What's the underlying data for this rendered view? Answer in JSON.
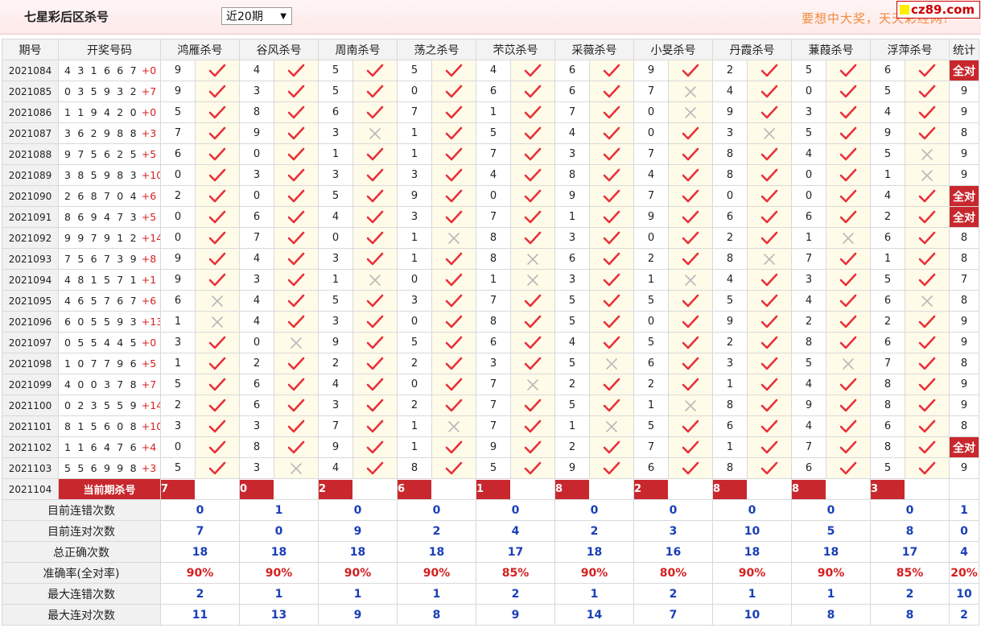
{
  "header": {
    "title": "七星彩后区杀号",
    "period_select": "近20期",
    "slogan": "要想中大奖，天天彩经网!",
    "site_badge": "cz89.com"
  },
  "columns": {
    "period": "期号",
    "numbers": "开奖号码",
    "experts": [
      "鸿雁杀号",
      "谷风杀号",
      "周南杀号",
      "荡之杀号",
      "芣苡杀号",
      "采薇杀号",
      "小旻杀号",
      "丹霞杀号",
      "蒹葭杀号",
      "浮萍杀号"
    ],
    "stats": "统计"
  },
  "rows": [
    {
      "period": "2021084",
      "nums": "4 3 1 6 6 7",
      "sum": "+0",
      "kills": [
        9,
        4,
        5,
        5,
        4,
        6,
        9,
        2,
        5,
        6
      ],
      "ok": [
        1,
        1,
        1,
        1,
        1,
        1,
        1,
        1,
        1,
        1
      ],
      "stat": "全对"
    },
    {
      "period": "2021085",
      "nums": "0 3 5 9 3 2",
      "sum": "+7",
      "kills": [
        9,
        3,
        5,
        0,
        6,
        6,
        7,
        4,
        0,
        5
      ],
      "ok": [
        1,
        1,
        1,
        1,
        1,
        1,
        0,
        1,
        1,
        1
      ],
      "stat": "9"
    },
    {
      "period": "2021086",
      "nums": "1 1 9 4 2 0",
      "sum": "+0",
      "kills": [
        5,
        8,
        6,
        7,
        1,
        7,
        0,
        9,
        3,
        4
      ],
      "ok": [
        1,
        1,
        1,
        1,
        1,
        1,
        0,
        1,
        1,
        1
      ],
      "stat": "9"
    },
    {
      "period": "2021087",
      "nums": "3 6 2 9 8 8",
      "sum": "+3",
      "kills": [
        7,
        9,
        3,
        1,
        5,
        4,
        0,
        3,
        5,
        9
      ],
      "ok": [
        1,
        1,
        0,
        1,
        1,
        1,
        1,
        0,
        1,
        1
      ],
      "stat": "8"
    },
    {
      "period": "2021088",
      "nums": "9 7 5 6 2 5",
      "sum": "+5",
      "kills": [
        6,
        0,
        1,
        1,
        7,
        3,
        7,
        8,
        4,
        5
      ],
      "ok": [
        1,
        1,
        1,
        1,
        1,
        1,
        1,
        1,
        1,
        0
      ],
      "stat": "9"
    },
    {
      "period": "2021089",
      "nums": "3 8 5 9 8 3",
      "sum": "+10",
      "kills": [
        0,
        3,
        3,
        3,
        4,
        8,
        4,
        8,
        0,
        1
      ],
      "ok": [
        1,
        1,
        1,
        1,
        1,
        1,
        1,
        1,
        1,
        0
      ],
      "stat": "9"
    },
    {
      "period": "2021090",
      "nums": "2 6 8 7 0 4",
      "sum": "+6",
      "kills": [
        2,
        0,
        5,
        9,
        0,
        9,
        7,
        0,
        0,
        4
      ],
      "ok": [
        1,
        1,
        1,
        1,
        1,
        1,
        1,
        1,
        1,
        1
      ],
      "stat": "全对"
    },
    {
      "period": "2021091",
      "nums": "8 6 9 4 7 3",
      "sum": "+5",
      "kills": [
        0,
        6,
        4,
        3,
        7,
        1,
        9,
        6,
        6,
        2
      ],
      "ok": [
        1,
        1,
        1,
        1,
        1,
        1,
        1,
        1,
        1,
        1
      ],
      "stat": "全对"
    },
    {
      "period": "2021092",
      "nums": "9 9 7 9 1 2",
      "sum": "+14",
      "kills": [
        0,
        7,
        0,
        1,
        8,
        3,
        0,
        2,
        1,
        6
      ],
      "ok": [
        1,
        1,
        1,
        0,
        1,
        1,
        1,
        1,
        0,
        1
      ],
      "stat": "8"
    },
    {
      "period": "2021093",
      "nums": "7 5 6 7 3 9",
      "sum": "+8",
      "kills": [
        9,
        4,
        3,
        1,
        8,
        6,
        2,
        8,
        7,
        1
      ],
      "ok": [
        1,
        1,
        1,
        1,
        0,
        1,
        1,
        0,
        1,
        1
      ],
      "stat": "8"
    },
    {
      "period": "2021094",
      "nums": "4 8 1 5 7 1",
      "sum": "+1",
      "kills": [
        9,
        3,
        1,
        0,
        1,
        3,
        1,
        4,
        3,
        5
      ],
      "ok": [
        1,
        1,
        0,
        1,
        0,
        1,
        0,
        1,
        1,
        1
      ],
      "stat": "7"
    },
    {
      "period": "2021095",
      "nums": "4 6 5 7 6 7",
      "sum": "+6",
      "kills": [
        6,
        4,
        5,
        3,
        7,
        5,
        5,
        5,
        4,
        6
      ],
      "ok": [
        0,
        1,
        1,
        1,
        1,
        1,
        1,
        1,
        1,
        0
      ],
      "stat": "8"
    },
    {
      "period": "2021096",
      "nums": "6 0 5 5 9 3",
      "sum": "+13",
      "kills": [
        1,
        4,
        3,
        0,
        8,
        5,
        0,
        9,
        2,
        2
      ],
      "ok": [
        0,
        1,
        1,
        1,
        1,
        1,
        1,
        1,
        1,
        1
      ],
      "stat": "9"
    },
    {
      "period": "2021097",
      "nums": "0 5 5 4 4 5",
      "sum": "+0",
      "kills": [
        3,
        0,
        9,
        5,
        6,
        4,
        5,
        2,
        8,
        6
      ],
      "ok": [
        1,
        0,
        1,
        1,
        1,
        1,
        1,
        1,
        1,
        1
      ],
      "stat": "9"
    },
    {
      "period": "2021098",
      "nums": "1 0 7 7 9 6",
      "sum": "+5",
      "kills": [
        1,
        2,
        2,
        2,
        3,
        5,
        6,
        3,
        5,
        7
      ],
      "ok": [
        1,
        1,
        1,
        1,
        1,
        0,
        1,
        1,
        0,
        1
      ],
      "stat": "8"
    },
    {
      "period": "2021099",
      "nums": "4 0 0 3 7 8",
      "sum": "+7",
      "kills": [
        5,
        6,
        4,
        0,
        7,
        2,
        2,
        1,
        4,
        8
      ],
      "ok": [
        1,
        1,
        1,
        1,
        0,
        1,
        1,
        1,
        1,
        1
      ],
      "stat": "9"
    },
    {
      "period": "2021100",
      "nums": "0 2 3 5 5 9",
      "sum": "+14",
      "kills": [
        2,
        6,
        3,
        2,
        7,
        5,
        1,
        8,
        9,
        8
      ],
      "ok": [
        1,
        1,
        1,
        1,
        1,
        1,
        0,
        1,
        1,
        1
      ],
      "stat": "9"
    },
    {
      "period": "2021101",
      "nums": "8 1 5 6 0 8",
      "sum": "+10",
      "kills": [
        3,
        3,
        7,
        1,
        7,
        1,
        5,
        6,
        4,
        6
      ],
      "ok": [
        1,
        1,
        1,
        0,
        1,
        0,
        1,
        1,
        1,
        1
      ],
      "stat": "8"
    },
    {
      "period": "2021102",
      "nums": "1 1 6 4 7 6",
      "sum": "+4",
      "kills": [
        0,
        8,
        9,
        1,
        9,
        2,
        7,
        1,
        7,
        8
      ],
      "ok": [
        1,
        1,
        1,
        1,
        1,
        1,
        1,
        1,
        1,
        1
      ],
      "stat": "全对"
    },
    {
      "period": "2021103",
      "nums": "5 5 6 9 9 8",
      "sum": "+3",
      "kills": [
        5,
        3,
        4,
        8,
        5,
        9,
        6,
        8,
        6,
        5
      ],
      "ok": [
        1,
        0,
        1,
        1,
        1,
        1,
        1,
        1,
        1,
        1
      ],
      "stat": "9"
    }
  ],
  "current": {
    "period": "2021104",
    "label": "当前期杀号",
    "kills": [
      7,
      0,
      2,
      6,
      1,
      8,
      2,
      8,
      8,
      3
    ]
  },
  "summary": [
    {
      "label": "目前连错次数",
      "style": "b",
      "values": [
        "0",
        "1",
        "0",
        "0",
        "0",
        "0",
        "0",
        "0",
        "0",
        "0"
      ],
      "stat": "1"
    },
    {
      "label": "目前连对次数",
      "style": "b",
      "values": [
        "7",
        "0",
        "9",
        "2",
        "4",
        "2",
        "3",
        "10",
        "5",
        "8"
      ],
      "stat": "0"
    },
    {
      "label": "总正确次数",
      "style": "b",
      "values": [
        "18",
        "18",
        "18",
        "18",
        "17",
        "18",
        "16",
        "18",
        "18",
        "17"
      ],
      "stat": "4"
    },
    {
      "label": "准确率(全对率)",
      "style": "r",
      "values": [
        "90%",
        "90%",
        "90%",
        "90%",
        "85%",
        "90%",
        "80%",
        "90%",
        "90%",
        "85%"
      ],
      "stat": "20%"
    },
    {
      "label": "最大连错次数",
      "style": "b",
      "values": [
        "2",
        "1",
        "1",
        "1",
        "2",
        "1",
        "2",
        "1",
        "1",
        "2"
      ],
      "stat": "10"
    },
    {
      "label": "最大连对次数",
      "style": "b",
      "values": [
        "11",
        "13",
        "9",
        "8",
        "9",
        "14",
        "7",
        "10",
        "8",
        "8"
      ],
      "stat": "2"
    }
  ],
  "colors": {
    "accent": "#c8282d",
    "check": "#e8313a",
    "cross": "#b9b9b9",
    "blue": "#1a3fb8"
  },
  "icons": {
    "ok": "check-icon",
    "fail": "cross-icon"
  }
}
